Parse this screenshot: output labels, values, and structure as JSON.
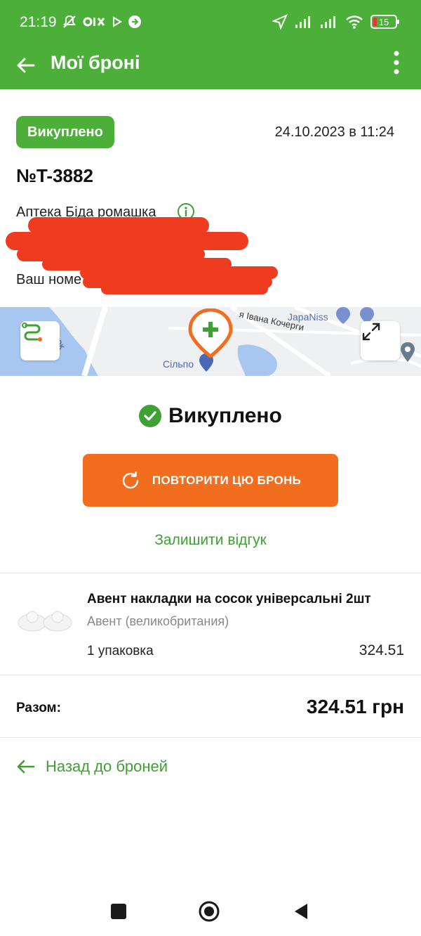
{
  "status_bar": {
    "time": "21:19",
    "battery": "15"
  },
  "app_bar": {
    "title": "Мої броні"
  },
  "order": {
    "badge": "Викуплено",
    "datetime": "24.10.2023 в 11:24",
    "number": "№T-3882",
    "pharmacy": "Аптека Біда ромашка",
    "phone_label": "Ваш номе"
  },
  "map": {
    "labels": {
      "street": "я Івана Кочерги",
      "store1": "JapaNiss",
      "store2": "Сільпо",
      "water": "к  ок"
    }
  },
  "status_section": {
    "status_text": "Викуплено",
    "repeat_button": "ПОВТОРИТИ ЦЮ БРОНЬ",
    "review_link": "Залишити відгук"
  },
  "product": {
    "name": "Авент накладки на сосок універсальні 2шт",
    "brand": "Авент (великобритания)",
    "quantity": "1 упаковка",
    "price": "324.51"
  },
  "total": {
    "label": "Разом:",
    "value": "324.51 грн"
  },
  "back_link": "Назад до броней",
  "colors": {
    "brand_green": "#4caf3a",
    "accent_orange": "#f36d1e",
    "link_green": "#3fa033",
    "redaction": "#ef3b1f"
  }
}
